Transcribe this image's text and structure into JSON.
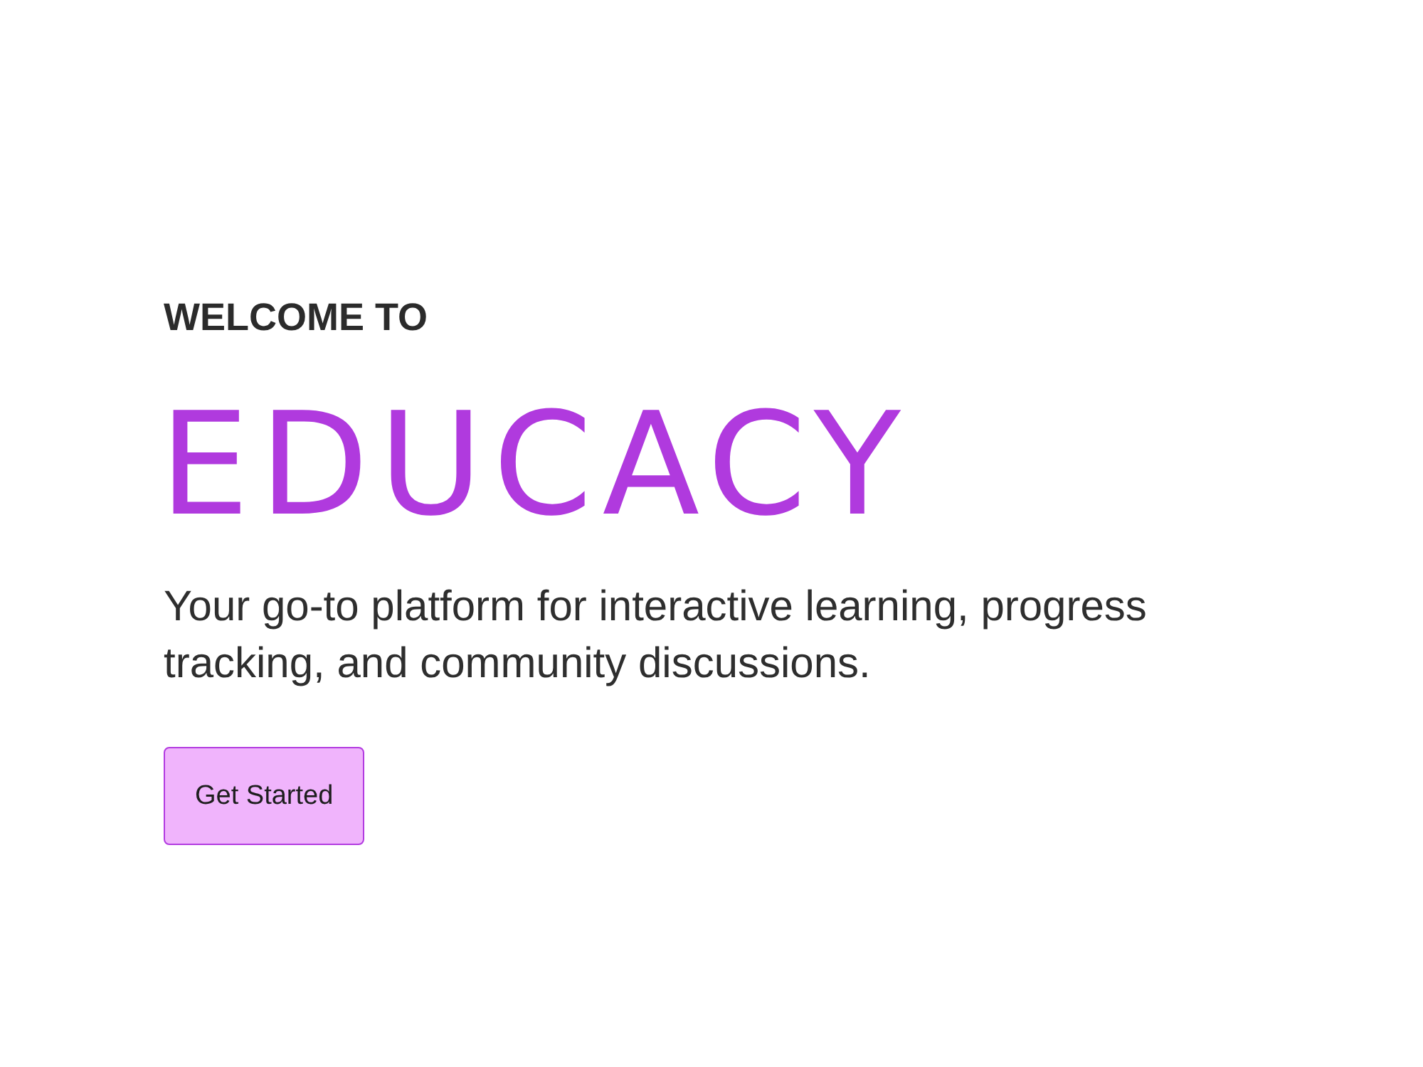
{
  "hero": {
    "eyebrow": "WELCOME TO",
    "brand": "EDUCACY",
    "tagline": "Your go-to platform for interactive learning, progress tracking, and community discussions.",
    "button": {
      "label": "Get Started"
    }
  }
}
